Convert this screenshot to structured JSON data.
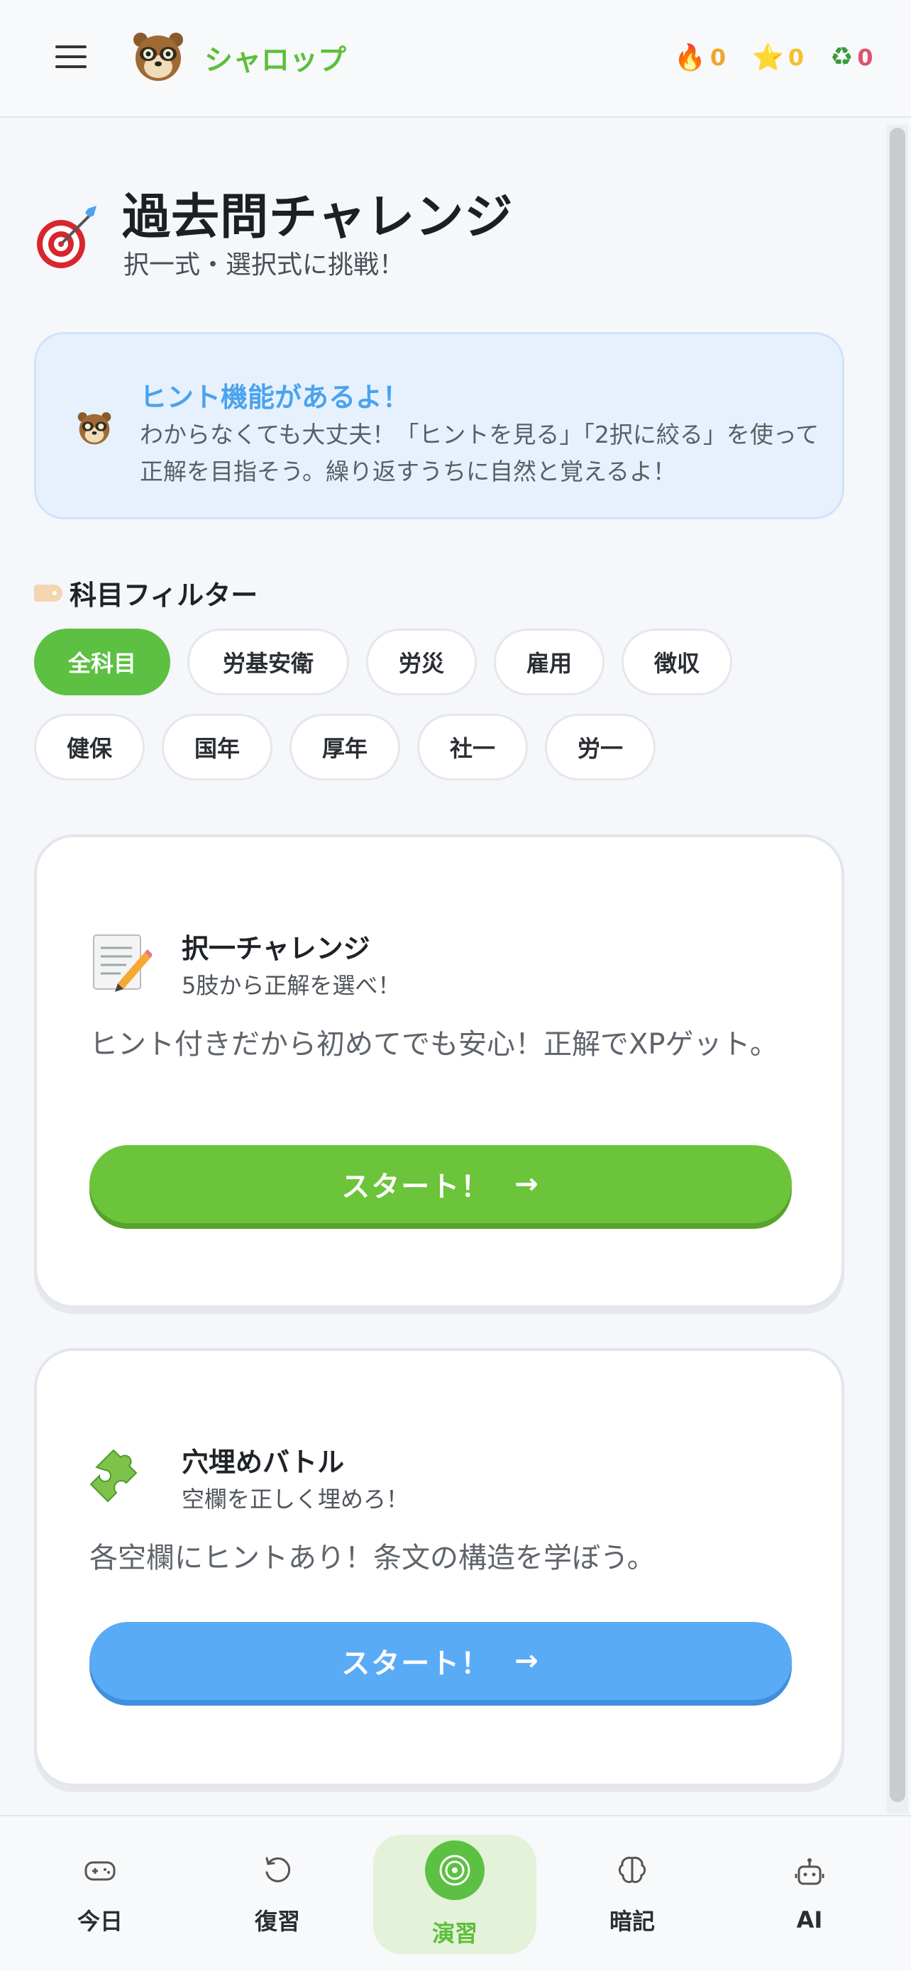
{
  "header": {
    "brand": "シャロップ",
    "stats": {
      "streak": "0",
      "xp": "0",
      "cycle": "0"
    },
    "icons": [
      "menu-icon",
      "mascot-logo",
      "fire-icon",
      "star-icon",
      "recycle-icon"
    ]
  },
  "page": {
    "title": "過去問チャレンジ",
    "subtitle": "択一式・選択式に挑戦！",
    "icon": "target-dart-icon"
  },
  "hint": {
    "title": "ヒント機能があるよ！",
    "text": "わからなくても大丈夫！「ヒントを見る」「2択に絞る」を使って正解を目指そう。繰り返すうちに自然と覚えるよ！"
  },
  "filter": {
    "title": "科目フィルター",
    "chips": [
      "全科目",
      "労基安衛",
      "労災",
      "雇用",
      "徴収",
      "健保",
      "国年",
      "厚年",
      "社一",
      "労一"
    ],
    "selected": "全科目"
  },
  "cards": [
    {
      "title": "択一チャレンジ",
      "subtitle": "5肢から正解を選べ！",
      "description": "ヒント付きだから初めてでも安心！正解でXPゲット。",
      "button": "スタート！",
      "icon": "memo-pencil-icon",
      "accent": "#6cc43a"
    },
    {
      "title": "穴埋めバトル",
      "subtitle": "空欄を正しく埋めろ！",
      "description": "各空欄にヒントあり！条文の構造を学ぼう。",
      "button": "スタート！",
      "icon": "puzzle-piece-icon",
      "accent": "#5aabf6"
    }
  ],
  "nav": {
    "items": [
      {
        "label": "今日",
        "icon": "gamepad-icon"
      },
      {
        "label": "復習",
        "icon": "refresh-icon"
      },
      {
        "label": "演習",
        "icon": "target-icon"
      },
      {
        "label": "暗記",
        "icon": "brain-icon"
      },
      {
        "label": "AI",
        "icon": "robot-icon"
      }
    ],
    "active": "演習"
  },
  "colors": {
    "brand_green": "#5cbf3a",
    "hint_blue": "#4aa3ef",
    "streak_orange": "#f0a52a",
    "xp_yellow": "#f3c12c",
    "cycle_pink": "#e0516d"
  }
}
